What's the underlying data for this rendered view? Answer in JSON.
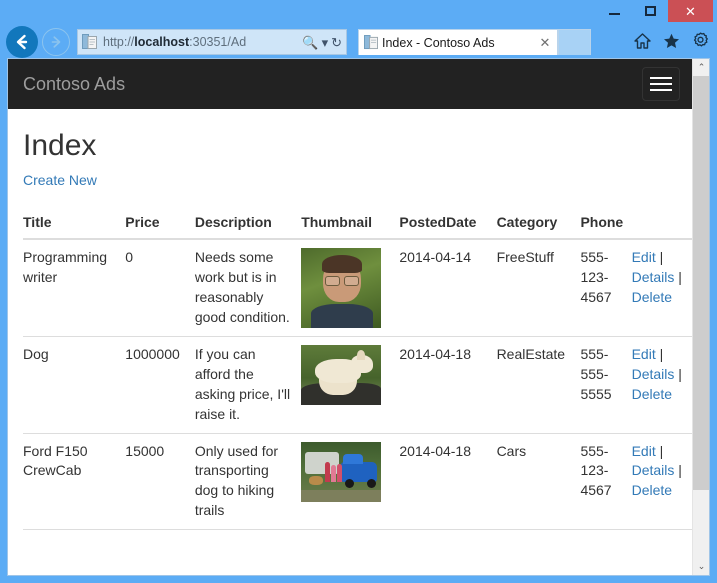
{
  "browser": {
    "window_controls": {
      "minimize": "—",
      "maximize": "□",
      "close": "✕"
    },
    "back_icon": "back-arrow-icon",
    "forward_icon": "forward-arrow-icon",
    "address": {
      "url_prefix": "http://",
      "url_host": "localhost",
      "url_suffix": ":30351/Ad",
      "full_url": "http://localhost:30351/Ad",
      "search_icon": "🔍",
      "dropdown_icon": "▾",
      "refresh_icon": "↻"
    },
    "tab": {
      "title": "Index - Contoso Ads",
      "close_label": "✕",
      "favicon": "page-icon"
    },
    "newtab_label": "",
    "tools": {
      "home": "⌂",
      "favorites": "★",
      "settings": "⚙"
    }
  },
  "site": {
    "brand": "Contoso Ads",
    "menu_toggle": "navbar-toggle"
  },
  "page": {
    "title": "Index",
    "create_new": "Create New"
  },
  "table": {
    "headers": [
      "Title",
      "Price",
      "Description",
      "Thumbnail",
      "PostedDate",
      "Category",
      "Phone",
      ""
    ],
    "action_labels": {
      "edit": "Edit",
      "details": "Details",
      "delete": "Delete",
      "separator": "|"
    },
    "rows": [
      {
        "title": "Programming writer",
        "price": "0",
        "description": "Needs some work but is in reasonably good condition.",
        "thumbnail": "man-with-glasses-photo",
        "posted_date": "2014-04-14",
        "category": "FreeStuff",
        "phone": "555-123-4567"
      },
      {
        "title": "Dog",
        "price": "1000000",
        "description": "If you can afford the asking price, I'll raise it.",
        "thumbnail": "white-dog-photo",
        "posted_date": "2014-04-18",
        "category": "RealEstate",
        "phone": "555-555-5555"
      },
      {
        "title": "Ford F150 CrewCab",
        "price": "15000",
        "description": "Only used for transporting dog to hiking trails",
        "thumbnail": "blue-truck-photo",
        "posted_date": "2014-04-18",
        "category": "Cars",
        "phone": "555-123-4567"
      }
    ]
  },
  "scrollbar": {
    "up": "⌃",
    "down": "⌄"
  },
  "colors": {
    "window_frame": "#5cacf5",
    "navbar_bg": "#222222",
    "brand_text": "#9d9d9d",
    "link": "#337ab7",
    "close_button": "#cb5055"
  }
}
